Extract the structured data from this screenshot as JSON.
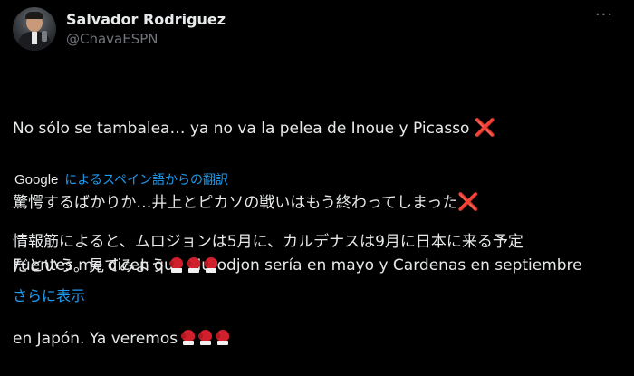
{
  "author": {
    "display_name": "Salvador Rodriguez",
    "handle": "@ChavaESPN"
  },
  "tweet": {
    "line1": "No sólo se tambalea… ya no va la pelea de Inoue y Picasso",
    "line2": "Fuentes me dicen que Murodjon sería en mayo y Cardenas en septiembre",
    "line3": "en Japón. Ya veremos"
  },
  "translation": {
    "provider": "Google",
    "link_text": "によるスペイン語からの翻訳",
    "line1": "驚愕するばかりか…井上とピカソの戦いはもう終わってしまった",
    "line2": "情報筋によると、ムロジョンは5月に、カルデナスは9月に日本に来る予定",
    "line3": "だという。見てみよう"
  },
  "show_more": "さらに表示",
  "icons": {
    "more": "more-options-icon",
    "cross": "cross-mark-icon",
    "glove": "boxing-glove-icon",
    "cross_glyph": "❌"
  },
  "colors": {
    "background": "#000000",
    "text": "#e7e9ea",
    "secondary": "#71767b",
    "link": "#1d9bf0",
    "cross": "#f4212e",
    "glove": "#d0202c"
  }
}
